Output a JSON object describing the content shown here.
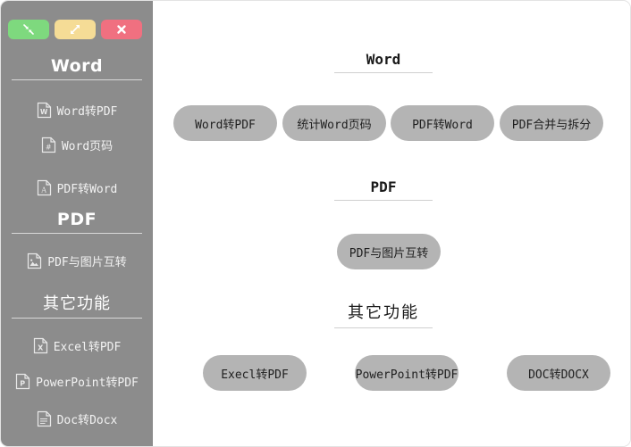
{
  "window": {
    "controls": [
      {
        "name": "minimize",
        "label": "",
        "icon": "collapse-arrows-icon",
        "color": "#7ED97E"
      },
      {
        "name": "maximize",
        "label": "",
        "icon": "expand-arrows-icon",
        "color": "#F5DC96"
      },
      {
        "name": "close",
        "label": "✕",
        "icon": "close-icon",
        "color": "#F07080"
      }
    ]
  },
  "sidebar": {
    "background": "#8C8C8C",
    "groups": [
      {
        "header": "Word",
        "script": "latin"
      },
      {
        "header": "PDF",
        "script": "latin"
      },
      {
        "header": "其它功能",
        "script": "cjk"
      }
    ],
    "items": [
      {
        "label": "Word转PDF",
        "icon": "word-doc-icon",
        "glyph": "W"
      },
      {
        "label": "Word页码",
        "icon": "page-number-icon",
        "glyph": "№"
      },
      {
        "label": "PDF转Word",
        "icon": "pdf-doc-icon",
        "glyph": "A"
      },
      {
        "label": "PDF与图片互转",
        "icon": "image-doc-icon",
        "glyph": "▲"
      },
      {
        "label": "Excel转PDF",
        "icon": "excel-doc-icon",
        "glyph": "X"
      },
      {
        "label": "PowerPoint转PDF",
        "icon": "powerpoint-doc-icon",
        "glyph": "P"
      },
      {
        "label": "Doc转Docx",
        "icon": "lines-doc-icon",
        "glyph": "≡"
      }
    ]
  },
  "main": {
    "sections": [
      {
        "title": "Word",
        "script": "latin",
        "buttons": [
          {
            "label": "Word转PDF"
          },
          {
            "label": "统计Word页码"
          },
          {
            "label": "PDF转Word"
          },
          {
            "label": "PDF合并与拆分"
          }
        ]
      },
      {
        "title": "PDF",
        "script": "latin",
        "buttons": [
          {
            "label": "PDF与图片互转"
          }
        ]
      },
      {
        "title": "其它功能",
        "script": "cjk",
        "buttons": [
          {
            "label": "Execl转PDF"
          },
          {
            "label": "PowerPoint转PDF"
          },
          {
            "label": "DOC转DOCX"
          }
        ]
      }
    ]
  },
  "colors": {
    "sidebar_bg": "#8C8C8C",
    "button_bg": "#B4B4B4",
    "content_bg": "#FFFFFF",
    "header_text": "#FFFFFF"
  }
}
